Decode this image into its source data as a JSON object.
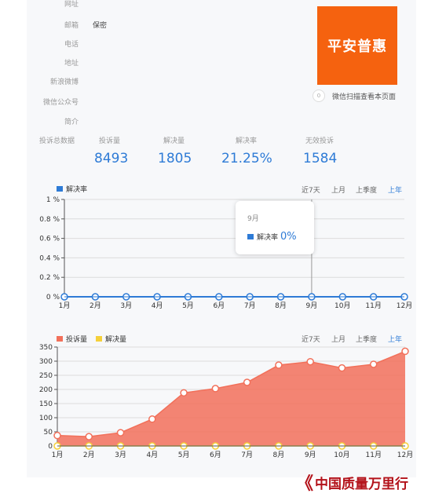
{
  "info": {
    "website_label": "网址",
    "email_label": "邮箱",
    "email_value": "保密",
    "phone_label": "电话",
    "address_label": "地址",
    "weibo_label": "新浪微博",
    "wechat_label": "微信公众号",
    "intro_label": "简介"
  },
  "qr": {
    "text": "平安普惠",
    "caption": "微信扫描查看本页面",
    "icon": "qr-code-icon",
    "icon_glyph": "0",
    "color": "#f5620f"
  },
  "stats": {
    "section_label": "投诉总数据",
    "items": [
      {
        "label": "投诉量",
        "value": "8493"
      },
      {
        "label": "解决量",
        "value": "1805"
      },
      {
        "label": "解决率",
        "value": "21.25%"
      },
      {
        "label": "无效投诉",
        "value": "1584"
      }
    ]
  },
  "range_tabs": [
    "近7天",
    "上月",
    "上季度",
    "上年"
  ],
  "range_active": "上年",
  "tooltip": {
    "month": "9月",
    "series": "解决率",
    "value": "0%"
  },
  "watermark": {
    "mark": "《",
    "text": "中国质量万里行"
  },
  "chart_data": [
    {
      "type": "line",
      "legend": [
        {
          "name": "解决率",
          "color": "#2e7bd6"
        }
      ],
      "x": [
        "1月",
        "2月",
        "3月",
        "4月",
        "5月",
        "6月",
        "7月",
        "8月",
        "9月",
        "10月",
        "11月",
        "12月"
      ],
      "series": [
        {
          "name": "解决率",
          "values": [
            0,
            0,
            0,
            0,
            0,
            0,
            0,
            0,
            0,
            0,
            0,
            0
          ],
          "color": "#2e7bd6"
        }
      ],
      "yticks": [
        "0 %",
        "0.2 %",
        "0.4 %",
        "0.6 %",
        "0.8 %",
        "1 %"
      ],
      "ylim": [
        0,
        1
      ],
      "grid": true,
      "highlight_index": 8
    },
    {
      "type": "area",
      "legend": [
        {
          "name": "投诉量",
          "color": "#f2705a"
        },
        {
          "name": "解决量",
          "color": "#f5d03a"
        }
      ],
      "x": [
        "1月",
        "2月",
        "3月",
        "4月",
        "5月",
        "6月",
        "7月",
        "8月",
        "9月",
        "10月",
        "11月",
        "12月"
      ],
      "series": [
        {
          "name": "投诉量",
          "values": [
            37,
            33,
            47,
            95,
            188,
            203,
            225,
            286,
            298,
            276,
            289,
            335
          ],
          "color": "#f2705a"
        },
        {
          "name": "解决量",
          "values": [
            0,
            0,
            0,
            0,
            0,
            0,
            0,
            0,
            0,
            0,
            0,
            0
          ],
          "color": "#f5d03a"
        }
      ],
      "yticks": [
        "0",
        "50",
        "100",
        "150",
        "200",
        "250",
        "300",
        "350"
      ],
      "ylim": [
        0,
        350
      ],
      "grid": true
    }
  ]
}
